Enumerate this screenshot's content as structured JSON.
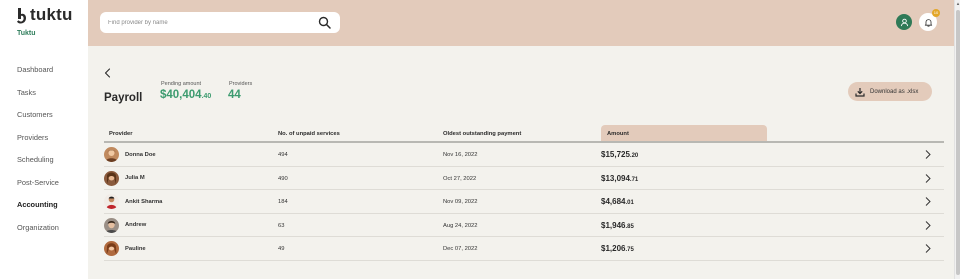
{
  "brand": {
    "name": "tuktu",
    "org": "Tuktu"
  },
  "sidebar": {
    "items": [
      {
        "label": "Dashboard",
        "active": false
      },
      {
        "label": "Tasks",
        "active": false
      },
      {
        "label": "Customers",
        "active": false
      },
      {
        "label": "Providers",
        "active": false
      },
      {
        "label": "Scheduling",
        "active": false
      },
      {
        "label": "Post-Service",
        "active": false
      },
      {
        "label": "Accounting",
        "active": true
      },
      {
        "label": "Organization",
        "active": false
      }
    ]
  },
  "topbar": {
    "search_placeholder": "Find provider by name",
    "notification_count": "10"
  },
  "page": {
    "title": "Payroll",
    "pending_label": "Pending amount",
    "pending_main": "$40,404",
    "pending_cents": ".40",
    "providers_label": "Providers",
    "providers_count": "44",
    "download_label": "Download as .xlsx"
  },
  "table": {
    "headers": {
      "provider": "Provider",
      "unpaid": "No. of unpaid services",
      "oldest": "Oldest outstanding payment",
      "amount": "Amount"
    },
    "rows": [
      {
        "name": "Donna Doe",
        "unpaid": "494",
        "oldest": "Nov 16, 2022",
        "amount_main": "$15,725",
        "amount_cents": ".20"
      },
      {
        "name": "Julia M",
        "unpaid": "490",
        "oldest": "Oct 27, 2022",
        "amount_main": "$13,094",
        "amount_cents": ".71"
      },
      {
        "name": "Ankit Sharma",
        "unpaid": "184",
        "oldest": "Nov 09, 2022",
        "amount_main": "$4,684",
        "amount_cents": ".01"
      },
      {
        "name": "Andrew",
        "unpaid": "63",
        "oldest": "Aug 24, 2022",
        "amount_main": "$1,946",
        "amount_cents": ".85"
      },
      {
        "name": "Pauline",
        "unpaid": "49",
        "oldest": "Dec 07, 2022",
        "amount_main": "$1,206",
        "amount_cents": ".75"
      }
    ]
  },
  "colors": {
    "accent": "#e3cbbb",
    "brand_green": "#3c9b6f",
    "background": "#f3f2ed"
  },
  "icons": [
    "tuktu-logo-icon",
    "search-icon",
    "user-icon",
    "bell-icon",
    "back-chevron-icon",
    "download-icon",
    "chevron-right-icon"
  ]
}
